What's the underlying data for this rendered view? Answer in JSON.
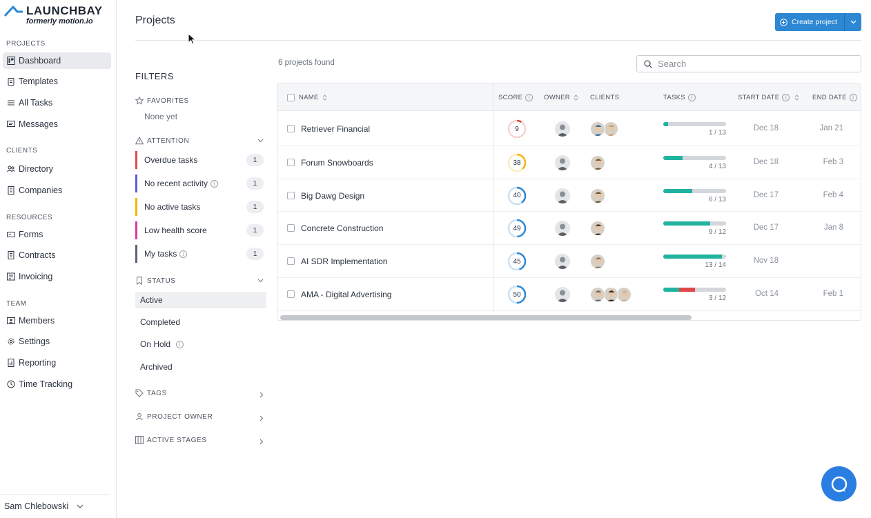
{
  "brand": {
    "name": "LAUNCHBAY",
    "subtitle": "formerly motion.io"
  },
  "sidebar": {
    "sections": [
      {
        "label": "PROJECTS",
        "items": [
          {
            "label": "Dashboard",
            "icon": "dashboard-icon",
            "active": true
          },
          {
            "label": "Templates",
            "icon": "clipboard-icon"
          },
          {
            "label": "All Tasks",
            "icon": "list-icon"
          },
          {
            "label": "Messages",
            "icon": "message-icon"
          }
        ]
      },
      {
        "label": "CLIENTS",
        "items": [
          {
            "label": "Directory",
            "icon": "people-icon"
          },
          {
            "label": "Companies",
            "icon": "building-icon"
          }
        ]
      },
      {
        "label": "RESOURCES",
        "items": [
          {
            "label": "Forms",
            "icon": "form-icon"
          },
          {
            "label": "Contracts",
            "icon": "document-icon"
          },
          {
            "label": "Invoicing",
            "icon": "invoice-icon"
          }
        ]
      },
      {
        "label": "TEAM",
        "items": [
          {
            "label": "Members",
            "icon": "id-card-icon"
          },
          {
            "label": "Settings",
            "icon": "gear-icon"
          },
          {
            "label": "Reporting",
            "icon": "report-icon"
          },
          {
            "label": "Time Tracking",
            "icon": "clock-icon"
          }
        ]
      }
    ],
    "user": "Sam Chlebowski"
  },
  "header": {
    "title": "Projects",
    "create_label": "Create project"
  },
  "filters": {
    "title": "FILTERS",
    "favorites_label": "FAVORITES",
    "favorites_empty": "None yet",
    "attention_label": "ATTENTION",
    "attention_items": [
      {
        "label": "Overdue tasks",
        "count": "1",
        "color": "#e04848",
        "info": false
      },
      {
        "label": "No recent activity",
        "count": "1",
        "color": "#5b5fd6",
        "info": true
      },
      {
        "label": "No active tasks",
        "count": "1",
        "color": "#f2b705",
        "info": false
      },
      {
        "label": "Low health score",
        "count": "1",
        "color": "#d63b9a",
        "info": false
      },
      {
        "label": "My tasks",
        "count": "1",
        "color": "#5a6270",
        "info": true
      }
    ],
    "status_label": "STATUS",
    "status_items": [
      {
        "label": "Active",
        "active": true,
        "info": false
      },
      {
        "label": "Completed",
        "active": false,
        "info": false
      },
      {
        "label": "On Hold",
        "active": false,
        "info": true
      },
      {
        "label": "Archived",
        "active": false,
        "info": false
      }
    ],
    "tags_label": "TAGS",
    "owner_label": "PROJECT OWNER",
    "stages_label": "ACTIVE STAGES"
  },
  "table": {
    "found_text": "6 projects found",
    "search_placeholder": "Search",
    "columns": {
      "name": "NAME",
      "score": "SCORE",
      "owner": "OWNER",
      "clients": "CLIENTS",
      "tasks": "TASKS",
      "start": "START DATE",
      "end": "END DATE"
    },
    "rows": [
      {
        "name": "Retriever Financial",
        "score": "9",
        "score_color": "#e04848",
        "score_pct": 0.09,
        "clients": 2,
        "tasks": "1 / 13",
        "tasks_done": 1,
        "tasks_total": 13,
        "tasks_overdue": 0,
        "start": "Dec 18",
        "end": "Jan 21"
      },
      {
        "name": "Forum Snowboards",
        "score": "38",
        "score_color": "#f2b705",
        "score_pct": 0.38,
        "clients": 1,
        "tasks": "4 / 13",
        "tasks_done": 4,
        "tasks_total": 13,
        "tasks_overdue": 0,
        "start": "Dec 18",
        "end": "Feb 3"
      },
      {
        "name": "Big Dawg Design",
        "score": "40",
        "score_color": "#2d87d3",
        "score_pct": 0.4,
        "clients": 1,
        "tasks": "6 / 13",
        "tasks_done": 6,
        "tasks_total": 13,
        "tasks_overdue": 0,
        "start": "Dec 17",
        "end": "Feb 4"
      },
      {
        "name": "Concrete Construction",
        "score": "49",
        "score_color": "#2d87d3",
        "score_pct": 0.49,
        "clients": 1,
        "tasks": "9 / 12",
        "tasks_done": 9,
        "tasks_total": 12,
        "tasks_overdue": 0,
        "start": "Dec 17",
        "end": "Jan 8"
      },
      {
        "name": "AI SDR Implementation",
        "score": "45",
        "score_color": "#2d87d3",
        "score_pct": 0.45,
        "clients": 1,
        "tasks": "13 / 14",
        "tasks_done": 13,
        "tasks_total": 14,
        "tasks_overdue": 0,
        "start": "Nov 18",
        "end": ""
      },
      {
        "name": "AMA - Digital Advertising",
        "score": "50",
        "score_color": "#2d87d3",
        "score_pct": 0.5,
        "clients": 3,
        "tasks": "3 / 12",
        "tasks_done": 3,
        "tasks_total": 12,
        "tasks_overdue": 3,
        "start": "Oct 14",
        "end": "Feb 1"
      }
    ]
  },
  "colors": {
    "accent": "#2d87d3",
    "task_progress": "#22b3a0",
    "task_overdue": "#e04848",
    "help_button": "#2a7de1"
  }
}
